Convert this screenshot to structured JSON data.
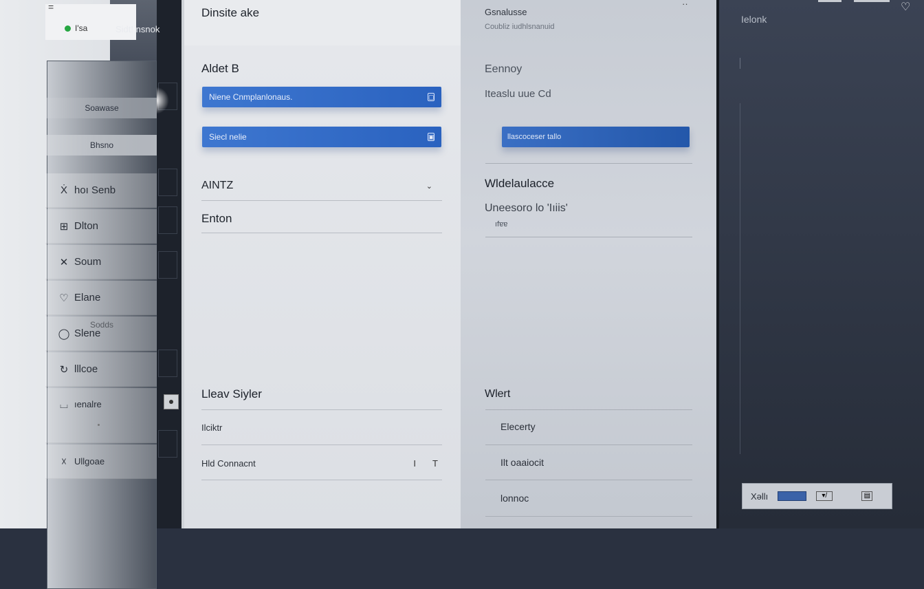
{
  "nav": {
    "top_mark": "=",
    "status_text": "I'sa",
    "status_brand": "Sidt! nsnok",
    "buttons": [
      {
        "label": "Sodds"
      },
      {
        "label": "Soawase"
      },
      {
        "label": "Bhsno"
      }
    ],
    "items": [
      {
        "icon": "Ẋ",
        "label": "hoı Senb"
      },
      {
        "icon": "⊞",
        "label": "Dlton"
      },
      {
        "icon": "✕",
        "label": "Soum"
      },
      {
        "icon": "♡",
        "label": "Elane"
      },
      {
        "icon": "◯",
        "label": "Slene"
      },
      {
        "icon": "↻",
        "label": "lllcoe"
      },
      {
        "icon": "⌴",
        "label": "ıenalre"
      },
      {
        "icon": "☓",
        "label": "Ullgoae"
      }
    ]
  },
  "main": {
    "title": "Dinsite ake",
    "section_a": "Aldet B",
    "field_1": "Niene Cnmplanlonaus.",
    "field_1_icon": "▢",
    "field_2": "Siecl nelie",
    "field_2_icon": "▣",
    "row_1": "AINTZ",
    "row_1_chevron": "⌄",
    "row_2": "Enton",
    "section_b": "Lleav Siyler",
    "list_1": "Ilciktr",
    "list_2": "Hld Connacnt",
    "list_2_marks": [
      "I",
      "T"
    ]
  },
  "detail": {
    "title": "Gsnalusse",
    "subtitle": "Coubliz iudhlsnanuid",
    "label_1": "Eennoy",
    "label_2": "Iteaslu uue Cd",
    "field": "llascoceser tallo",
    "heading": "Wldelaulacce",
    "text": "Uneesoro lo 'Iıiis'",
    "cursor": "ıfɐɐ",
    "list_heading": "Wlert",
    "items": [
      "Elecerty",
      "Ilt oaaiocit",
      "lonnoc"
    ]
  },
  "side": {
    "label": "Ielonk",
    "dock_text": "Xəllı",
    "dock_icon": "▾/",
    "dock_icon_2": "▤"
  },
  "header_dots": "··"
}
